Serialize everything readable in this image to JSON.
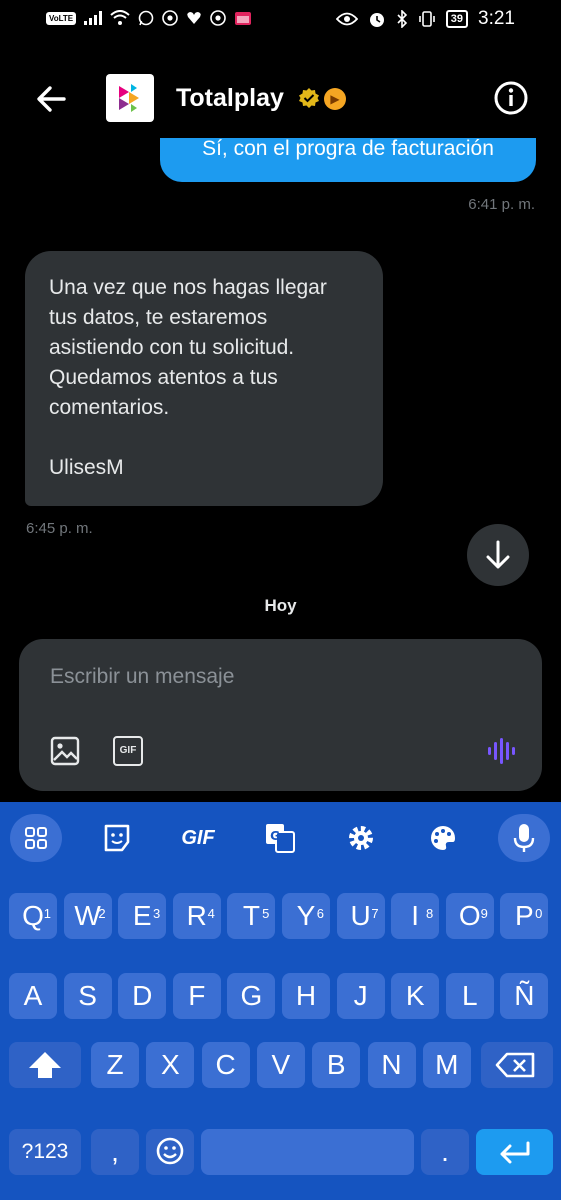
{
  "status_bar": {
    "network": "VoLTE",
    "battery": "39",
    "time": "3:21"
  },
  "header": {
    "title": "Totalplay"
  },
  "messages": {
    "outgoing_text": "Sí, con el progra de facturación",
    "outgoing_time": "6:41 p. m.",
    "incoming_lines": [
      "Una vez que nos hagas llegar",
      "tus datos, te estaremos",
      "asistiendo con tu solicitud.",
      "Quedamos atentos a tus",
      "comentarios."
    ],
    "incoming_signature": "UlisesM",
    "incoming_time": "6:45 p. m.",
    "day_separator": "Hoy"
  },
  "composer": {
    "placeholder": "Escribir un mensaje",
    "gif_label": "GIF"
  },
  "keyboard": {
    "toolbar_gif": "GIF",
    "row1": [
      {
        "k": "Q",
        "n": "1"
      },
      {
        "k": "W",
        "n": "2"
      },
      {
        "k": "E",
        "n": "3"
      },
      {
        "k": "R",
        "n": "4"
      },
      {
        "k": "T",
        "n": "5"
      },
      {
        "k": "Y",
        "n": "6"
      },
      {
        "k": "U",
        "n": "7"
      },
      {
        "k": "I",
        "n": "8"
      },
      {
        "k": "O",
        "n": "9"
      },
      {
        "k": "P",
        "n": "0"
      }
    ],
    "row2": [
      "A",
      "S",
      "D",
      "F",
      "G",
      "H",
      "J",
      "K",
      "L",
      "Ñ"
    ],
    "row3": [
      "Z",
      "X",
      "C",
      "V",
      "B",
      "N",
      "M"
    ],
    "symbols_key": "?123",
    "comma_key": ",",
    "period_key": "."
  },
  "colors": {
    "accent": "#1d9bf0",
    "bubble_in": "#2f3336",
    "keyboard_bg": "#1554c0",
    "key_bg": "#3b6fd3",
    "mic_purple": "#7856ff"
  }
}
